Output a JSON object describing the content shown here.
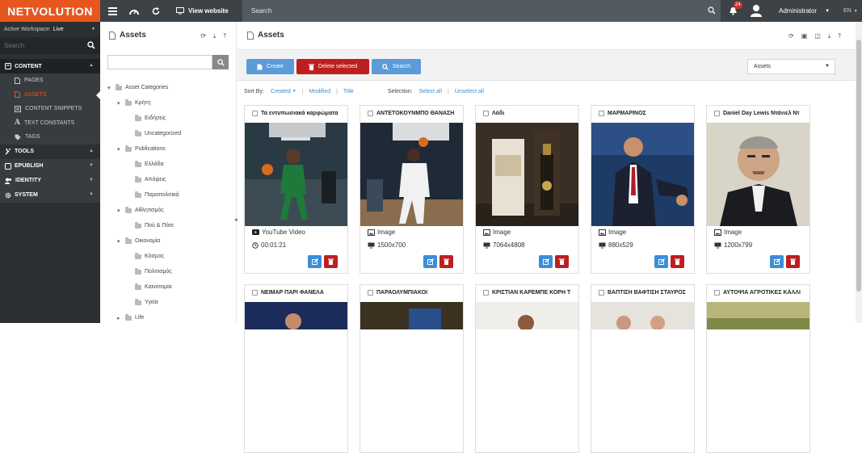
{
  "app": {
    "logo_text": "NETVOLUTION",
    "brand_color": "#e8561f"
  },
  "topbar": {
    "view_website_label": "View website",
    "search_placeholder": "Search",
    "notification_count": "24",
    "user_name": "Administrator",
    "language": "EN"
  },
  "leftnav": {
    "workspace_label": "Active Workspace:",
    "workspace_value": "Live",
    "search_placeholder": "Search",
    "sections": [
      {
        "label": "CONTENT",
        "icon": "book-icon",
        "items": [
          "PAGES",
          "ASSETS",
          "CONTENT SNIPPETS",
          "TEXT CONSTANTS",
          "TAGS"
        ]
      },
      {
        "label": "TOOLS",
        "icon": "wrench-icon"
      },
      {
        "label": "EPUBLISH",
        "icon": "book-icon"
      },
      {
        "label": "IDENTITY",
        "icon": "users-icon"
      },
      {
        "label": "SYSTEM",
        "icon": "gear-icon"
      }
    ],
    "active_item": "ASSETS"
  },
  "tree": {
    "title": "Assets",
    "rows": [
      {
        "label": "Asset Categories",
        "toggle": "▾"
      },
      {
        "label": "Κρήτη",
        "toggle": "▾"
      },
      {
        "label": "Ειδήσεις",
        "toggle": ""
      },
      {
        "label": "Uncategorized",
        "toggle": ""
      },
      {
        "label": "Publications",
        "toggle": "▾"
      },
      {
        "label": "Ελλάδα",
        "toggle": ""
      },
      {
        "label": "Απόψεις",
        "toggle": ""
      },
      {
        "label": "Παραπολιτικά",
        "toggle": ""
      },
      {
        "label": "Αθλητισμός",
        "toggle": "▾"
      },
      {
        "label": "Πού & Πότε",
        "toggle": ""
      },
      {
        "label": "Οικονομία",
        "toggle": "▾"
      },
      {
        "label": "Κόσμος",
        "toggle": ""
      },
      {
        "label": "Πολιτισμός",
        "toggle": ""
      },
      {
        "label": "Καινοτομία",
        "toggle": ""
      },
      {
        "label": "Υγεία",
        "toggle": ""
      },
      {
        "label": "Life",
        "toggle": "▸"
      }
    ]
  },
  "main": {
    "title": "Assets",
    "buttons": {
      "create": "Create",
      "delete_selected": "Delete selected",
      "search": "Search"
    },
    "filter_select": "Assets",
    "sort": {
      "label": "Sort By:",
      "created": "Created",
      "modified": "Modified",
      "title": "Title",
      "selection_label": "Selection:",
      "select_all": "Select all",
      "unselect_all": "Unselect all"
    }
  },
  "cards": [
    {
      "title": "Τα εντυπωσιακά καρφώματα",
      "type": "YouTube Video",
      "detail": "00:01:21",
      "type_icon": "youtube-icon",
      "detail_icon": "clock-icon"
    },
    {
      "title": "ΑΝΤΕΤΟΚΟΥΝΜΠΟ ΘΑΝΑΣΗ",
      "type": "Image",
      "detail": "1500x700",
      "type_icon": "image-icon",
      "detail_icon": "monitor-icon"
    },
    {
      "title": "Λάδι",
      "type": "Image",
      "detail": "7064x4808",
      "type_icon": "image-icon",
      "detail_icon": "monitor-icon"
    },
    {
      "title": "ΜΑΡΜΑΡΙΝΟΣ",
      "type": "Image",
      "detail": "880x529",
      "type_icon": "image-icon",
      "detail_icon": "monitor-icon"
    },
    {
      "title": "Daniel Day Lewis Ντάνιελ Ντ",
      "type": "Image",
      "detail": "1200x799",
      "type_icon": "image-icon",
      "detail_icon": "monitor-icon"
    },
    {
      "title": "ΝΕΙΜΑΡ ΠΑΡΙ ΦΑΝΕΛΑ"
    },
    {
      "title": "ΠΑΡΑΟΛΥΜΠΙΑΚΟΙ"
    },
    {
      "title": "ΚΡΙΣΤΙΑΝ ΚΑΡΕΜΠΕ ΚΟΡΗ Τ"
    },
    {
      "title": "ΒΑΠΤΙΣΗ ΒΑΦΤΙΣΗ ΣΤΑΥΡΟΣ"
    },
    {
      "title": "ΑΥΤΟΨΙΑ ΑΓΡΟΤΙΚΕΣ ΚΑΛΛΙ"
    }
  ]
}
